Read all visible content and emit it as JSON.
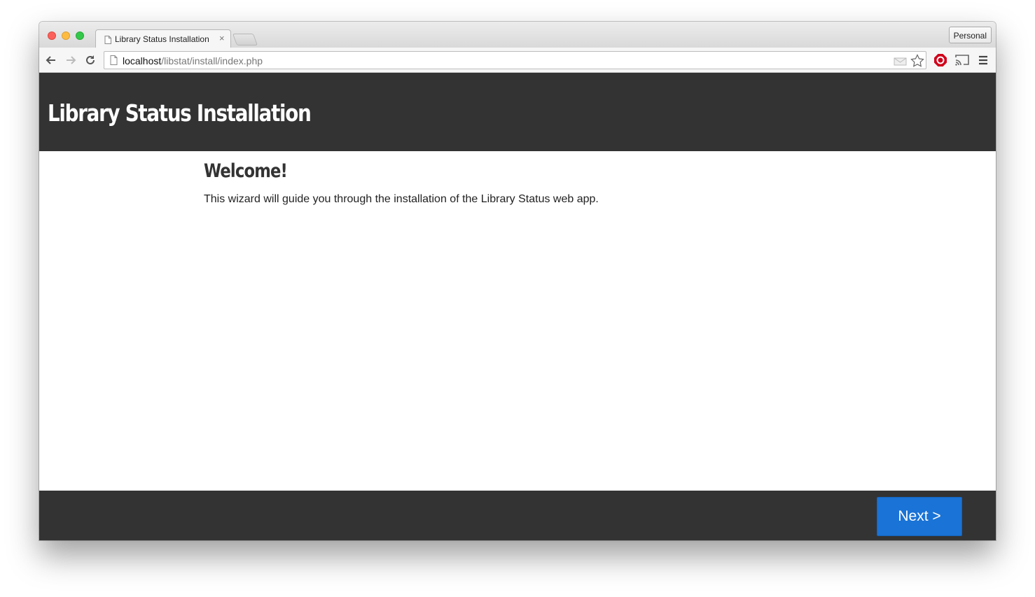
{
  "browser": {
    "tab_title": "Library Status Installation",
    "tab_close": "×",
    "profile_label": "Personal",
    "url_host": "localhost",
    "url_path": "/libstat/install/index.php"
  },
  "page": {
    "header_title": "Library Status Installation",
    "welcome_heading": "Welcome!",
    "intro_text": "This wizard will guide you through the installation of the Library Status web app.",
    "next_button": "Next >"
  },
  "colors": {
    "header_bg": "#333333",
    "accent": "#1a73d6",
    "page_bg": "#ffffff"
  }
}
